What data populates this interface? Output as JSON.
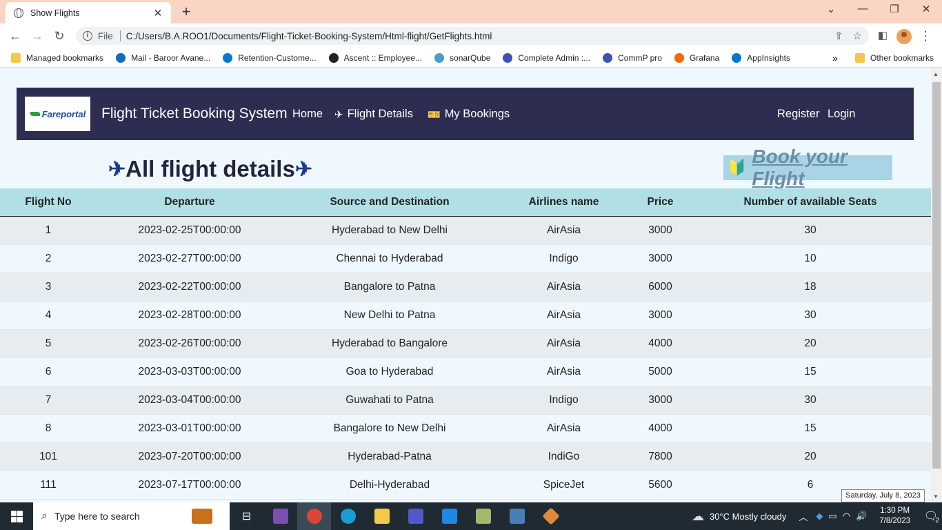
{
  "browser": {
    "tab_title": "Show Flights",
    "url_scheme": "File",
    "url": "C:/Users/B.A.ROO1/Documents/Flight-Ticket-Booking-System/Html-flight/GetFlights.html",
    "bookmarks": [
      {
        "label": "Managed bookmarks",
        "icon": "folder-icon",
        "color": "#f2c94c"
      },
      {
        "label": "Mail - Baroor Avane...",
        "icon": "outlook-icon",
        "color": "#0f6cbd"
      },
      {
        "label": "Retention-Custome...",
        "icon": "azure-devops-icon",
        "color": "#0078d4"
      },
      {
        "label": "Ascent :: Employee...",
        "icon": "ascent-icon",
        "color": "#222222"
      },
      {
        "label": "sonarQube",
        "icon": "sonarqube-icon",
        "color": "#4e9bcd"
      },
      {
        "label": "Complete Admin :...",
        "icon": "check-icon",
        "color": "#3f51b5"
      },
      {
        "label": "CommP pro",
        "icon": "check-icon",
        "color": "#3f51b5"
      },
      {
        "label": "Grafana",
        "icon": "grafana-icon",
        "color": "#f46800"
      },
      {
        "label": "AppInsights",
        "icon": "appinsights-icon",
        "color": "#0078d4"
      }
    ],
    "bookmarks_more": "»",
    "other_bookmarks": "Other bookmarks"
  },
  "navbar": {
    "logo_text": "Fareportal",
    "brand": "Flight Ticket Booking System",
    "links": {
      "home": "Home",
      "flight_details": "Flight Details",
      "my_bookings": "My Bookings",
      "register": "Register",
      "login": "Login"
    }
  },
  "main": {
    "heading": "All flight details",
    "book_link": "Book your Flight"
  },
  "table": {
    "headers": [
      "Flight No",
      "Departure",
      "Source and Destination",
      "Airlines name",
      "Price",
      "Number of available Seats"
    ],
    "rows": [
      [
        "1",
        "2023-02-25T00:00:00",
        "Hyderabad to New Delhi",
        "AirAsia",
        "3000",
        "30"
      ],
      [
        "2",
        "2023-02-27T00:00:00",
        "Chennai to Hyderabad",
        "Indigo",
        "3000",
        "10"
      ],
      [
        "3",
        "2023-02-22T00:00:00",
        "Bangalore to Patna",
        "AirAsia",
        "6000",
        "18"
      ],
      [
        "4",
        "2023-02-28T00:00:00",
        "New Delhi to Patna",
        "AirAsia",
        "3000",
        "30"
      ],
      [
        "5",
        "2023-02-26T00:00:00",
        "Hyderabad to Bangalore",
        "AirAsia",
        "4000",
        "20"
      ],
      [
        "6",
        "2023-03-03T00:00:00",
        "Goa to Hyderabad",
        "AirAsia",
        "5000",
        "15"
      ],
      [
        "7",
        "2023-03-04T00:00:00",
        "Guwahati to Patna",
        "Indigo",
        "3000",
        "30"
      ],
      [
        "8",
        "2023-03-01T00:00:00",
        "Bangalore to New Delhi",
        "AirAsia",
        "4000",
        "15"
      ],
      [
        "101",
        "2023-07-20T00:00:00",
        "Hyderabad-Patna",
        "IndiGo",
        "7800",
        "20"
      ],
      [
        "111",
        "2023-07-17T00:00:00",
        "Delhi-Hyderabad",
        "SpiceJet",
        "5600",
        "6"
      ]
    ]
  },
  "taskbar": {
    "search_placeholder": "Type here to search",
    "weather": "30°C  Mostly cloudy",
    "time": "1:30 PM",
    "date": "7/8/2023",
    "notification_count": "2",
    "tooltip": "Saturday, July 8, 2023"
  },
  "colors": {
    "navbar_bg": "#2d2d52",
    "table_header_bg": "#b0e0e6",
    "page_bg": "#f0f8ff",
    "tabbar_bg": "#f9d6c4"
  }
}
